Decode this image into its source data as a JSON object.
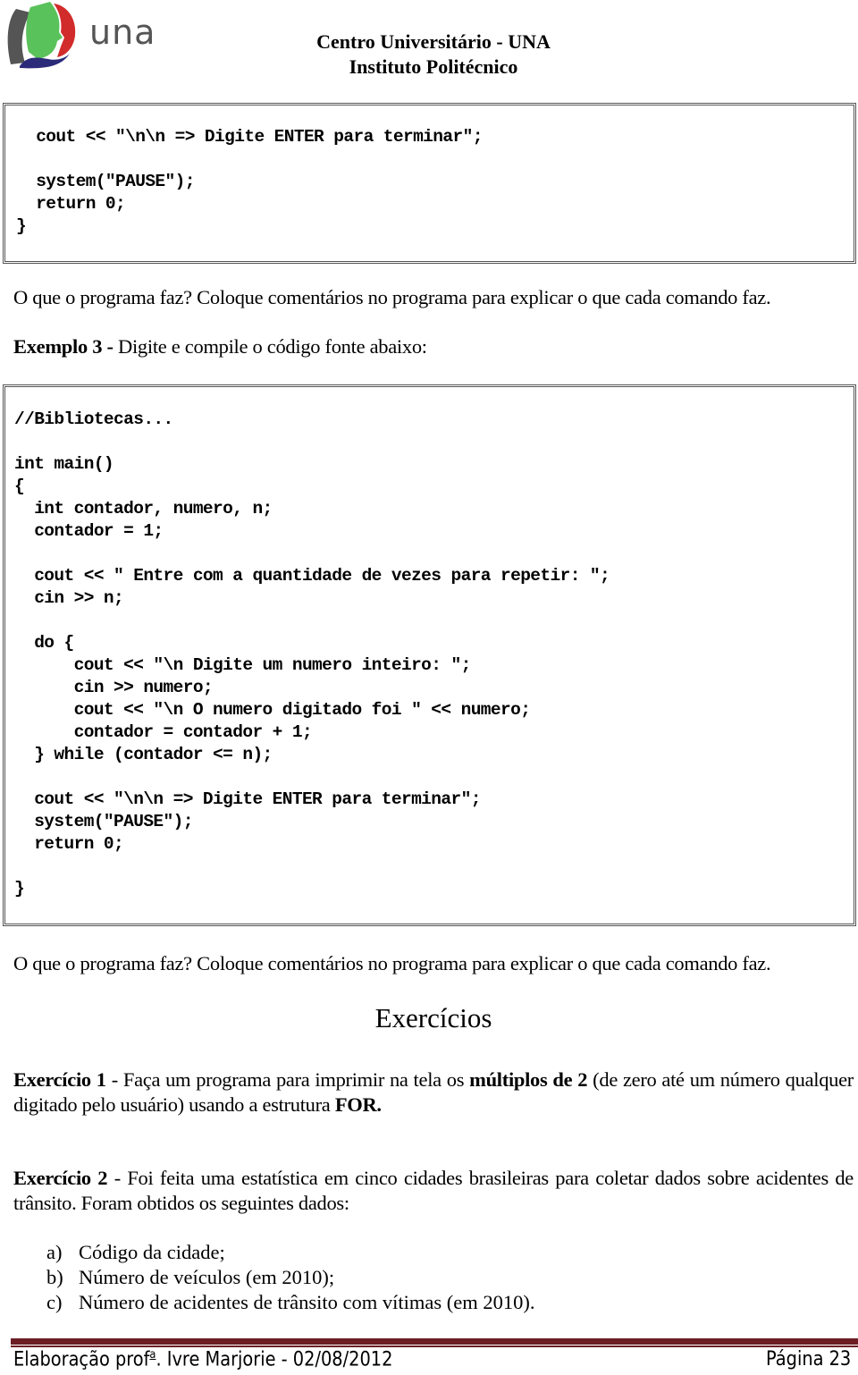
{
  "header": {
    "logo_text": "una",
    "institution": "Centro Universitário - UNA",
    "institute": "Instituto Politécnico"
  },
  "code_block_1": {
    "lines": [
      "  cout << \"\\n\\n => Digite ENTER para terminar\";",
      "",
      "  system(\"PAUSE\");",
      "  return 0;",
      "}"
    ]
  },
  "question_1": "O que o programa faz? Coloque comentários no programa para explicar o que cada comando faz.",
  "example_3": {
    "label": "Exemplo 3 -",
    "text": " Digite e compile o código fonte abaixo:"
  },
  "code_block_2": {
    "lines": [
      "//Bibliotecas...",
      "",
      "int main()",
      "{",
      "  int contador, numero, n;",
      "  contador = 1;",
      "",
      "  cout << \" Entre com a quantidade de vezes para repetir: \";",
      "  cin >> n;",
      "",
      "  do {",
      "      cout << \"\\n Digite um numero inteiro: \";",
      "      cin >> numero;",
      "      cout << \"\\n O numero digitado foi \" << numero;",
      "      contador = contador + 1;",
      "  } while (contador <= n);",
      "",
      "  cout << \"\\n\\n => Digite ENTER para terminar\";",
      "  system(\"PAUSE\");",
      "  return 0;",
      "",
      "}"
    ]
  },
  "question_2": "O que o programa faz? Coloque comentários no programa para explicar o que cada comando faz.",
  "exercises": {
    "title": "Exercícios",
    "ex1": {
      "label": "Exercício 1",
      "text_a": " - Faça um programa para imprimir na tela os ",
      "bold_a": "múltiplos de 2",
      "text_b": " (de zero até um número qualquer digitado pelo usuário) usando a estrutura ",
      "bold_b": "FOR."
    },
    "ex2": {
      "label": "Exercício 2",
      "text": " - Foi feita uma estatística em cinco cidades brasileiras para coletar dados sobre acidentes de trânsito. Foram obtidos os seguintes dados:",
      "items": [
        {
          "marker": "a)",
          "text": "Código da cidade;"
        },
        {
          "marker": "b)",
          "text": "Número de veículos (em 2010);"
        },
        {
          "marker": "c)",
          "text": "Número de acidentes de trânsito com vítimas (em 2010)."
        }
      ]
    }
  },
  "footer": {
    "author_prefix": "Elaboração prof",
    "author_sup": "a",
    "author_suffix": ". Ivre Marjorie - 02/08/2012",
    "page": "Página 23",
    "accent_color": "#6b1f24"
  }
}
